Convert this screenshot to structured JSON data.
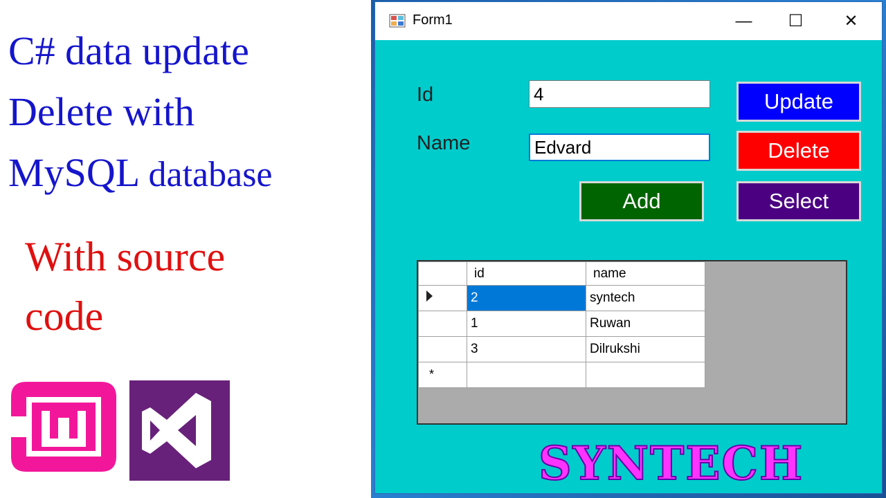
{
  "thumbnail": {
    "headline_line1": "C# data update",
    "headline_line2": "Delete with",
    "headline_line3_a": "MySQL",
    "headline_line3_b": "database",
    "subline_line1": "With source",
    "subline_line2": "code",
    "colors": {
      "headline": "#1515cc",
      "subline": "#e01010"
    }
  },
  "window": {
    "title": "Form1",
    "controls": {
      "minimize": "—",
      "maximize": "☐",
      "close": "✕"
    },
    "background": "#00cccc"
  },
  "form": {
    "id_label": "Id",
    "id_value": "4",
    "name_label": "Name",
    "name_value": "Edvard",
    "buttons": {
      "update": "Update",
      "delete": "Delete",
      "select": "Select",
      "add": "Add"
    },
    "colors": {
      "update": "#0000ff",
      "delete": "#ff0000",
      "select": "#4b0082",
      "add": "#006400"
    }
  },
  "grid": {
    "columns": [
      "id",
      "name"
    ],
    "rows": [
      {
        "id": "2",
        "name": "syntech"
      },
      {
        "id": "1",
        "name": "Ruwan"
      },
      {
        "id": "3",
        "name": "Dilrukshi"
      }
    ],
    "new_row_marker": "*"
  },
  "watermark": "SYNTECH",
  "icons": {
    "form_icon": "form-app-icon",
    "wamp": "wampserver-logo",
    "vs": "visual-studio-logo"
  }
}
